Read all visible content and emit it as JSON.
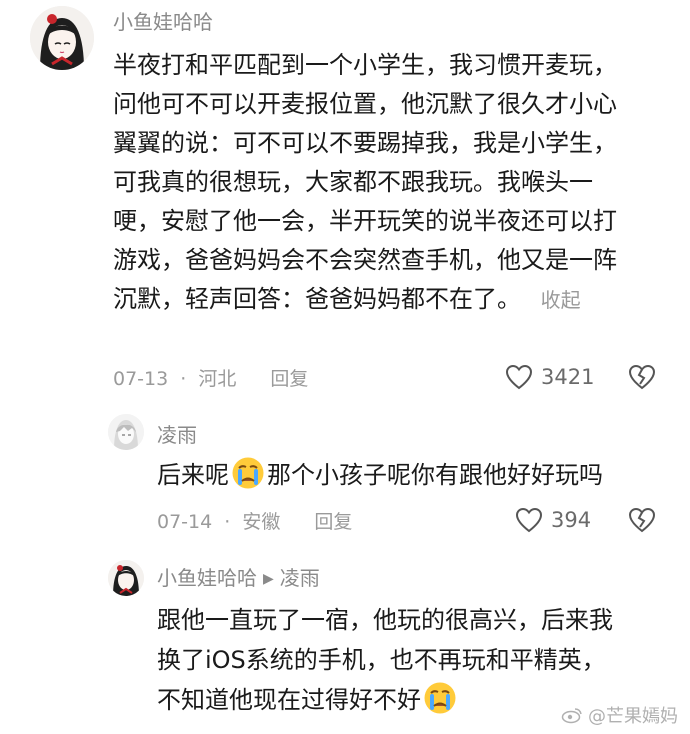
{
  "comments": [
    {
      "author": "小鱼娃哈哈",
      "text_lines": [
        "半夜打和平匹配到一个小学生，我习惯开麦玩，",
        "问他可不可以开麦报位置，他沉默了很久才小心",
        "翼翼的说：可不可以不要踢掉我，我是小学生，",
        "可我真的很想玩，大家都不跟我玩。我喉头一",
        "哽，安慰了他一会，半开玩笑的说半夜还可以打",
        "游戏，爸爸妈妈会不会突然查手机，他又是一阵",
        "沉默，轻声回答：爸爸妈妈都不在了。"
      ],
      "collapse_label": "收起",
      "date": "07-13",
      "location": "河北",
      "reply_label": "回复",
      "likes": "3421"
    },
    {
      "author": "凌雨",
      "text_before_emoji": "后来呢",
      "text_after_emoji": "那个小孩子呢你有跟他好好玩吗",
      "date": "07-14",
      "location": "安徽",
      "reply_label": "回复",
      "likes": "394"
    },
    {
      "author": "小鱼娃哈哈",
      "reply_to": "凌雨",
      "text_lines": [
        "跟他一直玩了一宿，他玩的很高兴，后来我",
        "换了iOS系统的手机，也不再玩和平精英，",
        "不知道他现在过得好不好"
      ]
    }
  ],
  "meta_separator": "·",
  "watermark": "@芒果嫣妈",
  "colors": {
    "text": "#1a1a1a",
    "secondary": "#9a9a9a",
    "emoji_face": "#ffcb3a"
  }
}
